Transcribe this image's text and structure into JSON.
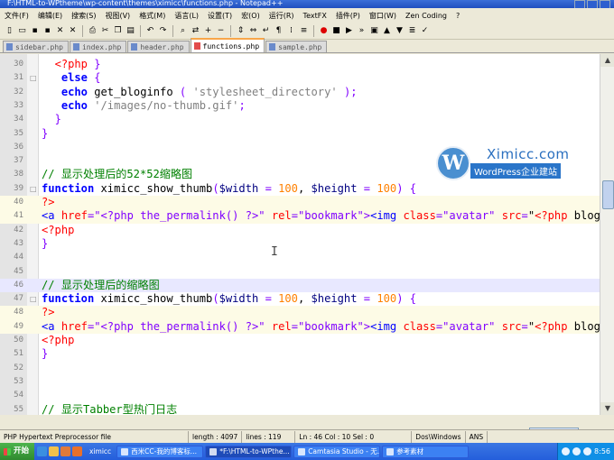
{
  "window": {
    "title": "F:\\HTML-to-WPtheme\\wp-content\\themes\\ximicc\\functions.php - Notepad++"
  },
  "menu": [
    "文件(F)",
    "编辑(E)",
    "搜索(S)",
    "视图(V)",
    "格式(M)",
    "语言(L)",
    "设置(T)",
    "宏(O)",
    "运行(R)",
    "TextFX",
    "插件(P)",
    "窗口(W)",
    "Zen Coding",
    "?"
  ],
  "toolbar_icons": [
    "new-file-icon",
    "open-file-icon",
    "save-icon",
    "save-all-icon",
    "close-icon",
    "close-all-icon",
    "print-icon",
    "cut-icon",
    "copy-icon",
    "paste-icon",
    "undo-icon",
    "redo-icon",
    "find-icon",
    "replace-icon",
    "zoom-in-icon",
    "zoom-out-icon",
    "sync-v-icon",
    "sync-h-icon",
    "word-wrap-icon",
    "all-chars-icon",
    "indent-guide-icon",
    "lang-icon",
    "record-macro-icon",
    "stop-macro-icon",
    "play-macro-icon",
    "run-multiple-icon",
    "save-macro-icon",
    "move-up-icon",
    "move-down-icon",
    "sort-icon",
    "spell-icon"
  ],
  "tabs": [
    {
      "label": "sidebar.php",
      "active": false
    },
    {
      "label": "index.php",
      "active": false
    },
    {
      "label": "header.php",
      "active": false
    },
    {
      "label": "functions.php",
      "active": true
    },
    {
      "label": "sample.php",
      "active": false
    }
  ],
  "editor": {
    "lines": [
      {
        "n": "30",
        "fold": "",
        "text": "  <?php }"
      },
      {
        "n": "31",
        "fold": "□",
        "text": "   else {"
      },
      {
        "n": "32",
        "fold": "",
        "text": "   echo get_bloginfo ( 'stylesheet_directory' );"
      },
      {
        "n": "33",
        "fold": "",
        "text": "   echo '/images/no-thumb.gif';"
      },
      {
        "n": "34",
        "fold": "",
        "text": "  }"
      },
      {
        "n": "35",
        "fold": "",
        "text": "}"
      },
      {
        "n": "36",
        "fold": "",
        "text": ""
      },
      {
        "n": "37",
        "fold": "",
        "text": ""
      },
      {
        "n": "38",
        "fold": "",
        "text": "// 显示处理后的52*52缩略图"
      },
      {
        "n": "39",
        "fold": "□",
        "text": "function ximicc_show_thumb($width = 100, $height = 100) {"
      },
      {
        "n": "40",
        "fold": "",
        "text": "?>"
      },
      {
        "n": "41",
        "fold": "",
        "text": "<a href=\"<?php the_permalink() ?>\" rel=\"bookmark\"><img class=\"avatar\" src=\"<?php bloginfo"
      },
      {
        "n": "42",
        "fold": "",
        "text": "<?php"
      },
      {
        "n": "43",
        "fold": "",
        "text": "}"
      },
      {
        "n": "44",
        "fold": "",
        "text": ""
      },
      {
        "n": "45",
        "fold": "",
        "text": ""
      },
      {
        "n": "46",
        "fold": "",
        "text": "// 显示处理后的缩略图"
      },
      {
        "n": "47",
        "fold": "□",
        "text": "function ximicc_show_thumb($width = 100, $height = 100) {"
      },
      {
        "n": "48",
        "fold": "",
        "text": "?>"
      },
      {
        "n": "49",
        "fold": "",
        "text": "<a href=\"<?php the_permalink() ?>\" rel=\"bookmark\"><img class=\"avatar\" src=\"<?php bloginfo"
      },
      {
        "n": "50",
        "fold": "",
        "text": "<?php"
      },
      {
        "n": "51",
        "fold": "",
        "text": "}"
      },
      {
        "n": "52",
        "fold": "",
        "text": ""
      },
      {
        "n": "53",
        "fold": "",
        "text": ""
      },
      {
        "n": "54",
        "fold": "",
        "text": ""
      },
      {
        "n": "55",
        "fold": "",
        "text": "// 显示Tabber型热门日志"
      }
    ]
  },
  "watermark": {
    "logo_letter": "W",
    "title": "Ximicc.com",
    "subtitle": "WordPress企业建站"
  },
  "status": {
    "file_type": "PHP Hypertext Preprocessor file",
    "length": "length : 4097",
    "lines": "lines : 119",
    "position": "Ln : 46   Col : 10   Sel : 0",
    "eol": "Dos\\Windows",
    "encoding": "ANS"
  },
  "ime": [
    "中",
    "°,",
    "☺",
    "✉",
    "⚙"
  ],
  "taskbar": {
    "start_label": "开始",
    "quick_launch": [
      "ie-icon",
      "folder-icon",
      "media-icon",
      "firefox-icon"
    ],
    "ximicc_label": "ximicc",
    "tasks": [
      {
        "label": "西米CC-我的博客标...",
        "active": false
      },
      {
        "label": "*F:\\HTML-to-WPthe...",
        "active": true
      },
      {
        "label": "Camtasia Studio - 无...",
        "active": false
      },
      {
        "label": "参考素材",
        "active": false
      }
    ],
    "clock": "8:56"
  }
}
